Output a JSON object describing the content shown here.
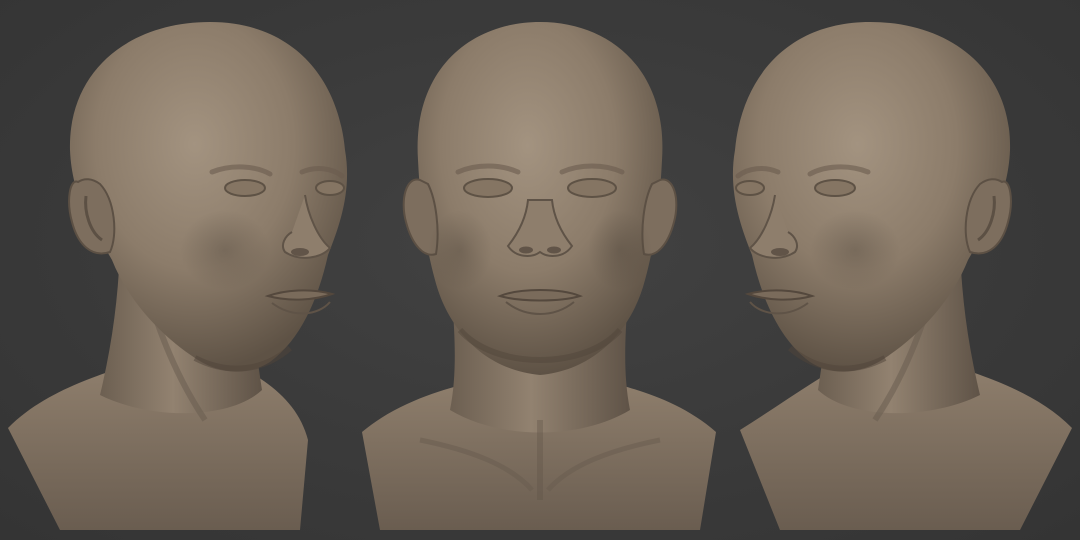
{
  "scene": {
    "background_color": "#3a3a3a",
    "material_color": "#8f7f6d",
    "views": [
      {
        "id": "three-quarter-right",
        "description_icon": "head-bust-icon"
      },
      {
        "id": "front",
        "description_icon": "head-bust-icon"
      },
      {
        "id": "three-quarter-left",
        "description_icon": "head-bust-icon"
      }
    ]
  }
}
